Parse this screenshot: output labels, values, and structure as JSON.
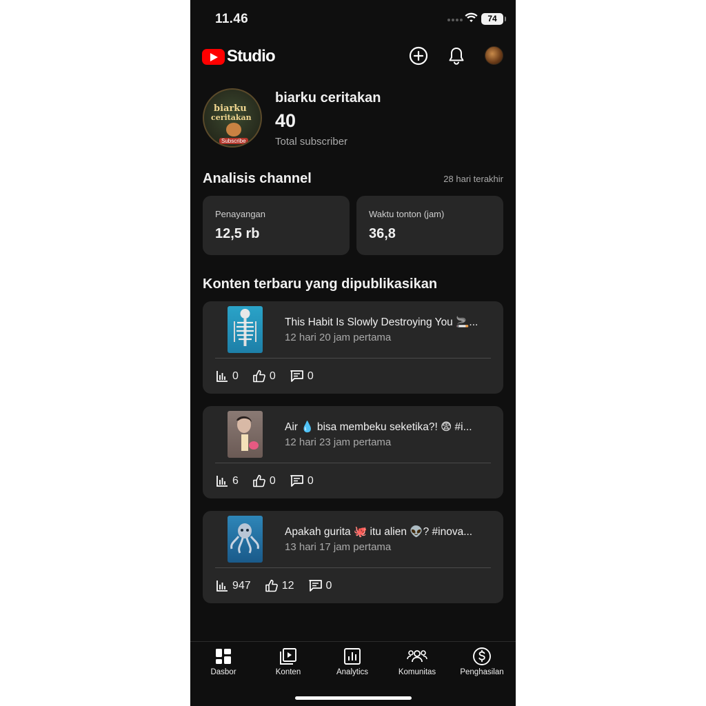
{
  "status_bar": {
    "time": "11.46",
    "battery": "74"
  },
  "app_bar": {
    "logo_text": "Studio",
    "icons": [
      "create-icon",
      "notification-bell-icon",
      "account-avatar"
    ]
  },
  "channel": {
    "name": "biarku ceritakan",
    "subscriber_count": "40",
    "subscriber_label": "Total subscriber",
    "avatar_text_1": "biarku",
    "avatar_text_2": "ceritakan",
    "avatar_badge": "Subscribe"
  },
  "analytics": {
    "title": "Analisis channel",
    "period": "28 hari terakhir",
    "cards": [
      {
        "label": "Penayangan",
        "value": "12,5 rb"
      },
      {
        "label": "Waktu tonton (jam)",
        "value": "36,8"
      }
    ]
  },
  "recent": {
    "title": "Konten terbaru yang dipublikasikan",
    "videos": [
      {
        "title": "This Habit Is Slowly Destroying You 🚬...",
        "meta": "12 hari 20 jam pertama",
        "views": "0",
        "likes": "0",
        "comments": "0"
      },
      {
        "title": "Air 💧 bisa membeku seketika?! 😨 #i...",
        "meta": "12 hari 23 jam pertama",
        "views": "6",
        "likes": "0",
        "comments": "0"
      },
      {
        "title": "Apakah gurita 🐙 itu alien 👽? #inova...",
        "meta": "13 hari 17 jam pertama",
        "views": "947",
        "likes": "12",
        "comments": "0"
      }
    ]
  },
  "bottom_nav": {
    "items": [
      {
        "label": "Dasbor",
        "icon": "dashboard-icon"
      },
      {
        "label": "Konten",
        "icon": "content-icon"
      },
      {
        "label": "Analytics",
        "icon": "analytics-icon"
      },
      {
        "label": "Komunitas",
        "icon": "community-icon"
      },
      {
        "label": "Penghasilan",
        "icon": "earn-icon"
      }
    ]
  },
  "colors": {
    "background": "#0f0f0f",
    "card": "#272727",
    "brand_red": "#ff0000",
    "secondary_text": "#aaaaaa"
  }
}
